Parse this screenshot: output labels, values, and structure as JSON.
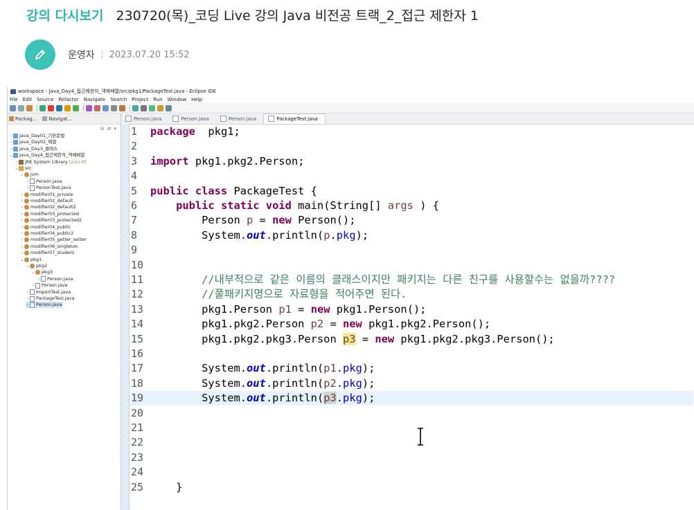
{
  "post": {
    "category": "강의 다시보기",
    "title": "230720(목)_코딩 Live 강의 Java 비전공 트랙_2_접근 제한자 1",
    "author": "운영자",
    "date": "2023.07.20 15:52"
  },
  "ide": {
    "window_title": "workspace - Java_Day4_접근제한자_객체배열/src/pkg1/PackageTest.java - Eclipse IDE",
    "menu": [
      "File",
      "Edit",
      "Source",
      "Refactor",
      "Navigate",
      "Search",
      "Project",
      "Run",
      "Window",
      "Help"
    ],
    "explorer_tabs": [
      "Packag...",
      "Navigat..."
    ],
    "tree": [
      {
        "label": "Java_Day01_기본문법",
        "indent": 0,
        "type": "project",
        "twisty": ">"
      },
      {
        "label": "Java_Day02_배열",
        "indent": 0,
        "type": "project",
        "twisty": ">"
      },
      {
        "label": "Java_Day3_클래스",
        "indent": 0,
        "type": "project",
        "twisty": ">"
      },
      {
        "label": "Java_Day4_접근제한자_객체배열",
        "indent": 0,
        "type": "project",
        "twisty": "v"
      },
      {
        "label": "JRE System Library",
        "suffix": "[zulu-8]",
        "indent": 1,
        "type": "lib",
        "twisty": ">"
      },
      {
        "label": "src",
        "indent": 1,
        "type": "src",
        "twisty": "v"
      },
      {
        "label": "jvm",
        "indent": 2,
        "type": "pkg",
        "twisty": "v"
      },
      {
        "label": "Person.java",
        "indent": 3,
        "type": "java",
        "twisty": ">"
      },
      {
        "label": "PersonTest.java",
        "indent": 3,
        "type": "java",
        "twisty": ">"
      },
      {
        "label": "modifier01_private",
        "indent": 2,
        "type": "pkg",
        "twisty": ">"
      },
      {
        "label": "modifier02_default",
        "indent": 2,
        "type": "pkg",
        "twisty": ">"
      },
      {
        "label": "modifier02_default2",
        "indent": 2,
        "type": "pkg",
        "twisty": ">"
      },
      {
        "label": "modifier03_protected",
        "indent": 2,
        "type": "pkg",
        "twisty": ">"
      },
      {
        "label": "modifier03_protected2",
        "indent": 2,
        "type": "pkg",
        "twisty": ">"
      },
      {
        "label": "modifier04_public",
        "indent": 2,
        "type": "pkg",
        "twisty": ">"
      },
      {
        "label": "modifier04_public2",
        "indent": 2,
        "type": "pkg",
        "twisty": ">"
      },
      {
        "label": "modifier05_getter_setter",
        "indent": 2,
        "type": "pkg",
        "twisty": ">"
      },
      {
        "label": "modifier06_singleton",
        "indent": 2,
        "type": "pkg",
        "twisty": ">"
      },
      {
        "label": "modifier07_student",
        "indent": 2,
        "type": "pkg",
        "twisty": ">"
      },
      {
        "label": "pkg1",
        "indent": 2,
        "type": "pkg",
        "twisty": "v"
      },
      {
        "label": "pkg2",
        "indent": 3,
        "type": "pkg",
        "twisty": "v"
      },
      {
        "label": "pkg3",
        "indent": 4,
        "type": "pkg",
        "twisty": "v"
      },
      {
        "label": "Person.java",
        "indent": 5,
        "type": "java",
        "twisty": ">"
      },
      {
        "label": "Person.java",
        "indent": 4,
        "type": "java",
        "twisty": ">"
      },
      {
        "label": "ImportTest.java",
        "indent": 3,
        "type": "java",
        "twisty": ">"
      },
      {
        "label": "PackageTest.java",
        "indent": 3,
        "type": "java",
        "twisty": ">"
      },
      {
        "label": "Person.java",
        "indent": 3,
        "type": "java",
        "twisty": ">",
        "selected": true
      }
    ],
    "editor_tabs": [
      {
        "label": "Person.java",
        "active": false
      },
      {
        "label": "Person.java",
        "active": false
      },
      {
        "label": "Person.java",
        "active": false
      },
      {
        "label": "PackageTest.java",
        "active": true
      }
    ],
    "current_line": 19,
    "code": [
      {
        "n": "1",
        "t": [
          [
            "kw",
            "package"
          ],
          [
            "",
            "  pkg1;"
          ]
        ]
      },
      {
        "n": "2",
        "t": []
      },
      {
        "n": "3",
        "t": [
          [
            "kw",
            "import"
          ],
          [
            "",
            " pkg1.pkg2.Person;"
          ]
        ]
      },
      {
        "n": "4",
        "t": []
      },
      {
        "n": "5",
        "t": [
          [
            "kw",
            "public class"
          ],
          [
            "",
            " PackageTest {"
          ]
        ]
      },
      {
        "n": "6",
        "t": [
          [
            "",
            "    "
          ],
          [
            "kw",
            "public static void"
          ],
          [
            "",
            " main(String[] "
          ],
          [
            "var",
            "args"
          ],
          [
            "",
            " ) {"
          ]
        ]
      },
      {
        "n": "7",
        "t": [
          [
            "",
            "        Person "
          ],
          [
            "var",
            "p"
          ],
          [
            "",
            " = "
          ],
          [
            "kw",
            "new"
          ],
          [
            "",
            " Person();"
          ]
        ]
      },
      {
        "n": "8",
        "t": [
          [
            "",
            "        System."
          ],
          [
            "sfld",
            "out"
          ],
          [
            "",
            ".println("
          ],
          [
            "var",
            "p"
          ],
          [
            "",
            "."
          ],
          [
            "fld",
            "pkg"
          ],
          [
            "",
            ");"
          ]
        ]
      },
      {
        "n": "9",
        "t": []
      },
      {
        "n": "10",
        "t": []
      },
      {
        "n": "11",
        "t": [
          [
            "",
            "        "
          ],
          [
            "cmt",
            "//내부적으로 같은 이름의 클래스이지만 패키지는 다른 친구를 사용할수는 없을까????"
          ]
        ]
      },
      {
        "n": "12",
        "t": [
          [
            "",
            "        "
          ],
          [
            "cmt",
            "//풀패키지명으로 자료형을 적어주면 된다."
          ]
        ]
      },
      {
        "n": "13",
        "t": [
          [
            "",
            "        pkg1.Person "
          ],
          [
            "var",
            "p1"
          ],
          [
            "",
            " = "
          ],
          [
            "kw",
            "new"
          ],
          [
            "",
            " pkg1.Person();"
          ]
        ]
      },
      {
        "n": "14",
        "t": [
          [
            "",
            "        pkg1.pkg2.Person "
          ],
          [
            "var",
            "p2"
          ],
          [
            "",
            " = "
          ],
          [
            "kw",
            "new"
          ],
          [
            "",
            " pkg1.pkg2.Person();"
          ]
        ]
      },
      {
        "n": "15",
        "t": [
          [
            "",
            "        pkg1.pkg2.pkg3.Person "
          ],
          [
            "var hl2",
            "p3"
          ],
          [
            "",
            " = "
          ],
          [
            "kw",
            "new"
          ],
          [
            "",
            " pkg1.pkg2.pkg3.Person();"
          ]
        ]
      },
      {
        "n": "16",
        "t": []
      },
      {
        "n": "17",
        "t": [
          [
            "",
            "        System."
          ],
          [
            "sfld",
            "out"
          ],
          [
            "",
            ".println("
          ],
          [
            "var",
            "p1"
          ],
          [
            "",
            "."
          ],
          [
            "fld",
            "pkg"
          ],
          [
            "",
            ");"
          ]
        ]
      },
      {
        "n": "18",
        "t": [
          [
            "",
            "        System."
          ],
          [
            "sfld",
            "out"
          ],
          [
            "",
            ".println("
          ],
          [
            "var",
            "p2"
          ],
          [
            "",
            "."
          ],
          [
            "fld",
            "pkg"
          ],
          [
            "",
            ");"
          ]
        ]
      },
      {
        "n": "19",
        "t": [
          [
            "",
            "        System."
          ],
          [
            "sfld",
            "out"
          ],
          [
            "",
            ".println("
          ],
          [
            "var hl",
            "p3"
          ],
          [
            "",
            "."
          ],
          [
            "fld",
            "pkg"
          ],
          [
            "",
            ");"
          ]
        ]
      },
      {
        "n": "20",
        "t": []
      },
      {
        "n": "21",
        "t": []
      },
      {
        "n": "22",
        "t": []
      },
      {
        "n": "23",
        "t": []
      },
      {
        "n": "24",
        "t": []
      },
      {
        "n": "25",
        "t": [
          [
            "",
            "    }"
          ]
        ]
      }
    ]
  }
}
